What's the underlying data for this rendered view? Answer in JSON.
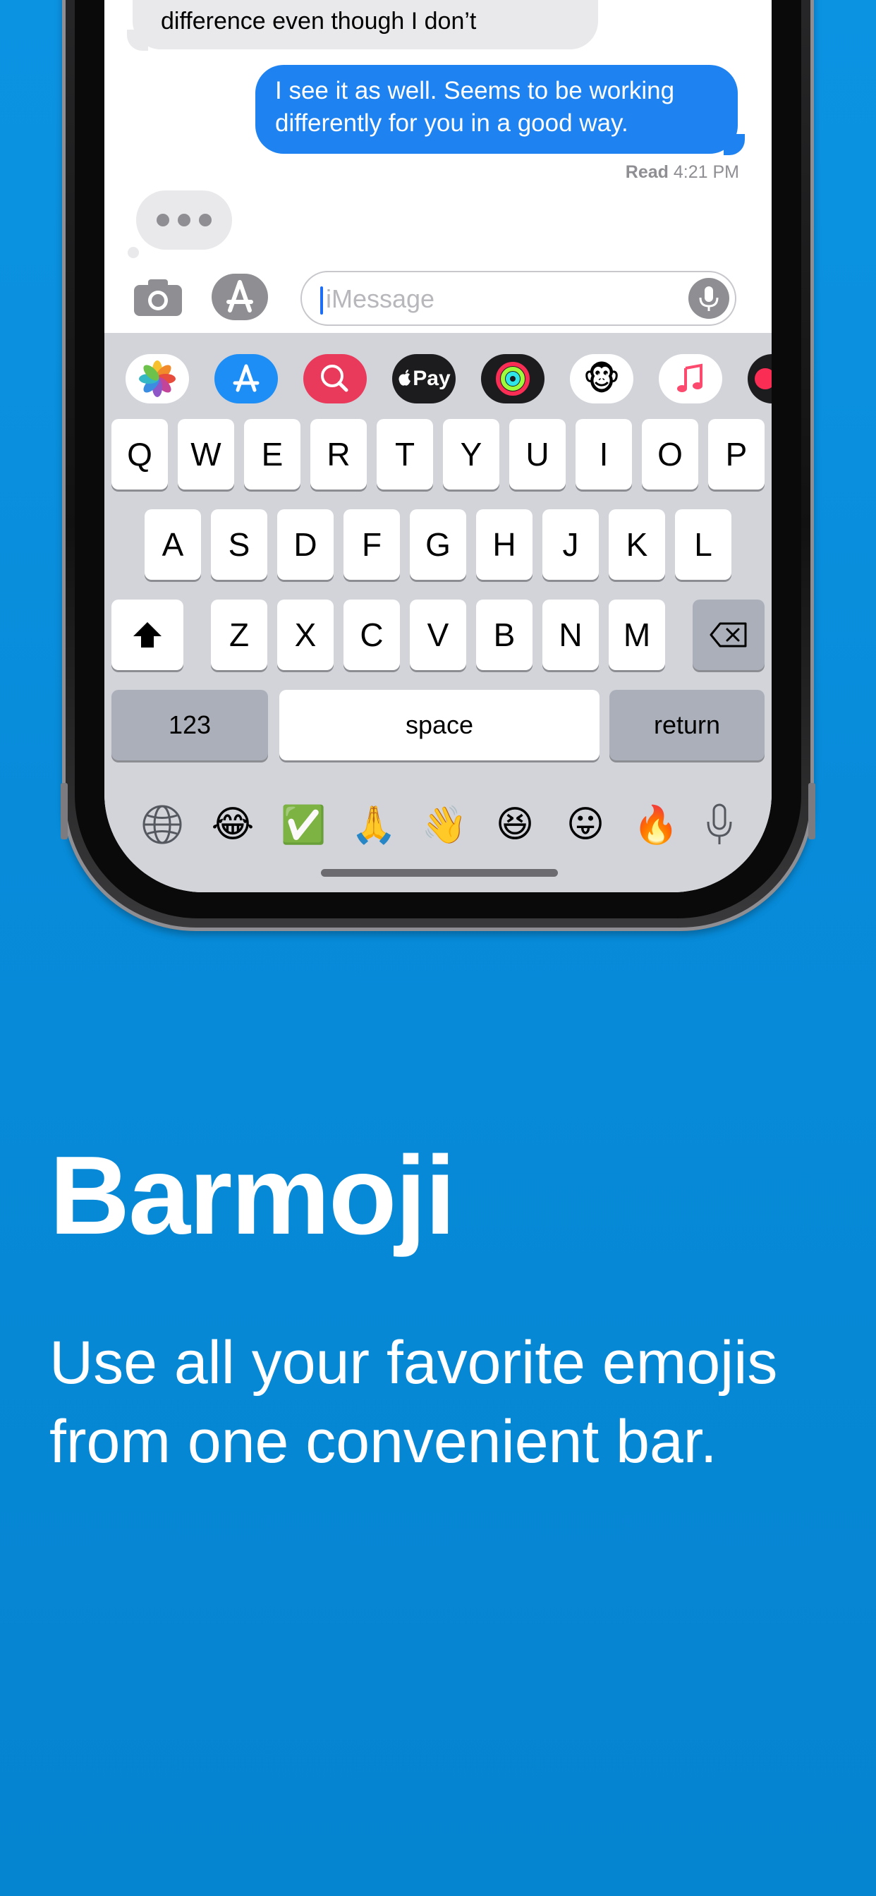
{
  "messages": {
    "incoming_partial": "difference even though I don’t",
    "outgoing": "I see it as well. Seems to be working differently for you in a good way.",
    "read_label": "Read",
    "read_time": "4:21 PM"
  },
  "input": {
    "placeholder": "iMessage"
  },
  "app_drawer": [
    "photos-app",
    "app-store-app",
    "search-images-app",
    "apple-pay-app",
    "activity-app",
    "animoji-app",
    "music-app",
    "digital-touch-app"
  ],
  "apple_pay_label": "Pay",
  "keyboard": {
    "row1": [
      "Q",
      "W",
      "E",
      "R",
      "T",
      "Y",
      "U",
      "I",
      "O",
      "P"
    ],
    "row2": [
      "A",
      "S",
      "D",
      "F",
      "G",
      "H",
      "J",
      "K",
      "L"
    ],
    "row3": [
      "Z",
      "X",
      "C",
      "V",
      "B",
      "N",
      "M"
    ],
    "numbers_label": "123",
    "space_label": "space",
    "return_label": "return"
  },
  "emoji_bar": [
    "😂",
    "✅",
    "🙏",
    "👋",
    "😆",
    "😛",
    "🔥"
  ],
  "headline": {
    "title": "Barmoji",
    "subtitle": "Use all your favorite emojis from one convenient bar."
  },
  "colors": {
    "background": "#0b8ddb",
    "bubble_blue": "#1e83f1",
    "keyboard_bg": "#d2d4da"
  }
}
